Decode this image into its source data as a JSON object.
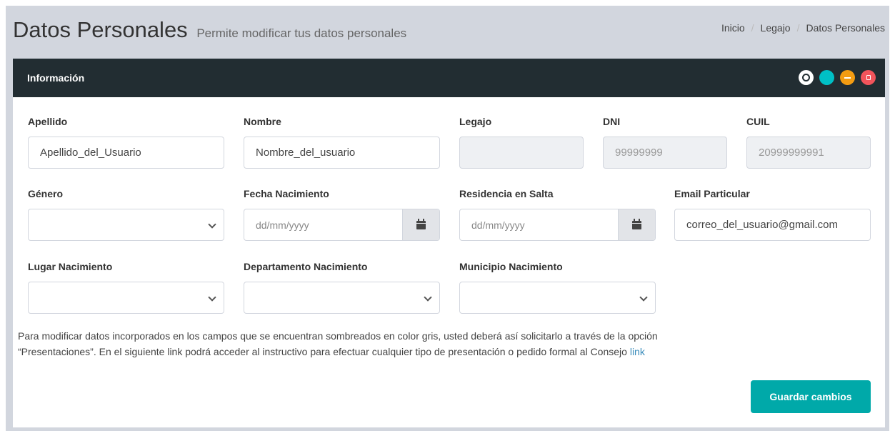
{
  "header": {
    "title": "Datos Personales",
    "subtitle": "Permite modificar tus datos personales",
    "breadcrumb": [
      "Inicio",
      "Legajo",
      "Datos Personales"
    ],
    "breadcrumb_separator": "/"
  },
  "box": {
    "title": "Información",
    "tool_colors": {
      "move": "#ffffff",
      "refresh": "#00c0c6",
      "minimize": "#f39c12",
      "close": "#f2545b"
    }
  },
  "fields": {
    "apellido": {
      "label": "Apellido",
      "value": "Apellido_del_Usuario"
    },
    "nombre": {
      "label": "Nombre",
      "value": "Nombre_del_usuario"
    },
    "legajo": {
      "label": "Legajo",
      "value": ""
    },
    "dni": {
      "label": "DNI",
      "value": "99999999"
    },
    "cuil": {
      "label": "CUIL",
      "value": "20999999991"
    },
    "genero": {
      "label": "Género",
      "value": ""
    },
    "fecha_nacimiento": {
      "label": "Fecha Nacimiento",
      "placeholder": "dd/mm/yyyy"
    },
    "residencia_salta": {
      "label": "Residencia en Salta",
      "placeholder": "dd/mm/yyyy"
    },
    "email": {
      "label": "Email Particular",
      "value": "correo_del_usuario@gmail.com"
    },
    "lugar_nacimiento": {
      "label": "Lugar Nacimiento",
      "value": ""
    },
    "departamento_nacimiento": {
      "label": "Departamento Nacimiento",
      "value": ""
    },
    "municipio_nacimiento": {
      "label": "Municipio Nacimiento",
      "value": ""
    }
  },
  "info": {
    "line1": "Para modificar datos incorporados en los campos que se encuentran sombreados en color gris, usted deberá así solicitarlo a través de la opción",
    "line2": "“Presentaciones”. En el siguiente link podrá acceder al instructivo para efectuar cualquier tipo de presentación o pedido formal al Consejo",
    "link_text": "link"
  },
  "actions": {
    "save_label": "Guardar cambios",
    "save_color": "#00a9a9"
  }
}
